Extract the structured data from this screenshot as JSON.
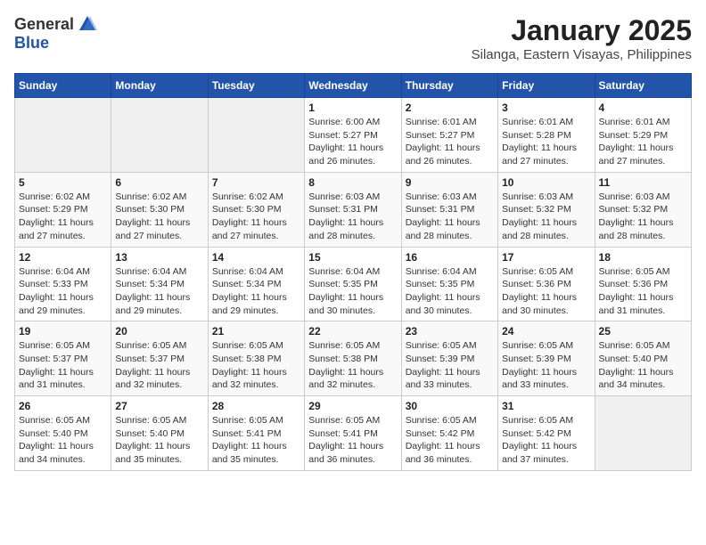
{
  "logo": {
    "general": "General",
    "blue": "Blue"
  },
  "header": {
    "month": "January 2025",
    "location": "Silanga, Eastern Visayas, Philippines"
  },
  "weekdays": [
    "Sunday",
    "Monday",
    "Tuesday",
    "Wednesday",
    "Thursday",
    "Friday",
    "Saturday"
  ],
  "weeks": [
    [
      {
        "day": "",
        "info": ""
      },
      {
        "day": "",
        "info": ""
      },
      {
        "day": "",
        "info": ""
      },
      {
        "day": "1",
        "info": "Sunrise: 6:00 AM\nSunset: 5:27 PM\nDaylight: 11 hours and 26 minutes."
      },
      {
        "day": "2",
        "info": "Sunrise: 6:01 AM\nSunset: 5:27 PM\nDaylight: 11 hours and 26 minutes."
      },
      {
        "day": "3",
        "info": "Sunrise: 6:01 AM\nSunset: 5:28 PM\nDaylight: 11 hours and 27 minutes."
      },
      {
        "day": "4",
        "info": "Sunrise: 6:01 AM\nSunset: 5:29 PM\nDaylight: 11 hours and 27 minutes."
      }
    ],
    [
      {
        "day": "5",
        "info": "Sunrise: 6:02 AM\nSunset: 5:29 PM\nDaylight: 11 hours and 27 minutes."
      },
      {
        "day": "6",
        "info": "Sunrise: 6:02 AM\nSunset: 5:30 PM\nDaylight: 11 hours and 27 minutes."
      },
      {
        "day": "7",
        "info": "Sunrise: 6:02 AM\nSunset: 5:30 PM\nDaylight: 11 hours and 27 minutes."
      },
      {
        "day": "8",
        "info": "Sunrise: 6:03 AM\nSunset: 5:31 PM\nDaylight: 11 hours and 28 minutes."
      },
      {
        "day": "9",
        "info": "Sunrise: 6:03 AM\nSunset: 5:31 PM\nDaylight: 11 hours and 28 minutes."
      },
      {
        "day": "10",
        "info": "Sunrise: 6:03 AM\nSunset: 5:32 PM\nDaylight: 11 hours and 28 minutes."
      },
      {
        "day": "11",
        "info": "Sunrise: 6:03 AM\nSunset: 5:32 PM\nDaylight: 11 hours and 28 minutes."
      }
    ],
    [
      {
        "day": "12",
        "info": "Sunrise: 6:04 AM\nSunset: 5:33 PM\nDaylight: 11 hours and 29 minutes."
      },
      {
        "day": "13",
        "info": "Sunrise: 6:04 AM\nSunset: 5:34 PM\nDaylight: 11 hours and 29 minutes."
      },
      {
        "day": "14",
        "info": "Sunrise: 6:04 AM\nSunset: 5:34 PM\nDaylight: 11 hours and 29 minutes."
      },
      {
        "day": "15",
        "info": "Sunrise: 6:04 AM\nSunset: 5:35 PM\nDaylight: 11 hours and 30 minutes."
      },
      {
        "day": "16",
        "info": "Sunrise: 6:04 AM\nSunset: 5:35 PM\nDaylight: 11 hours and 30 minutes."
      },
      {
        "day": "17",
        "info": "Sunrise: 6:05 AM\nSunset: 5:36 PM\nDaylight: 11 hours and 30 minutes."
      },
      {
        "day": "18",
        "info": "Sunrise: 6:05 AM\nSunset: 5:36 PM\nDaylight: 11 hours and 31 minutes."
      }
    ],
    [
      {
        "day": "19",
        "info": "Sunrise: 6:05 AM\nSunset: 5:37 PM\nDaylight: 11 hours and 31 minutes."
      },
      {
        "day": "20",
        "info": "Sunrise: 6:05 AM\nSunset: 5:37 PM\nDaylight: 11 hours and 32 minutes."
      },
      {
        "day": "21",
        "info": "Sunrise: 6:05 AM\nSunset: 5:38 PM\nDaylight: 11 hours and 32 minutes."
      },
      {
        "day": "22",
        "info": "Sunrise: 6:05 AM\nSunset: 5:38 PM\nDaylight: 11 hours and 32 minutes."
      },
      {
        "day": "23",
        "info": "Sunrise: 6:05 AM\nSunset: 5:39 PM\nDaylight: 11 hours and 33 minutes."
      },
      {
        "day": "24",
        "info": "Sunrise: 6:05 AM\nSunset: 5:39 PM\nDaylight: 11 hours and 33 minutes."
      },
      {
        "day": "25",
        "info": "Sunrise: 6:05 AM\nSunset: 5:40 PM\nDaylight: 11 hours and 34 minutes."
      }
    ],
    [
      {
        "day": "26",
        "info": "Sunrise: 6:05 AM\nSunset: 5:40 PM\nDaylight: 11 hours and 34 minutes."
      },
      {
        "day": "27",
        "info": "Sunrise: 6:05 AM\nSunset: 5:40 PM\nDaylight: 11 hours and 35 minutes."
      },
      {
        "day": "28",
        "info": "Sunrise: 6:05 AM\nSunset: 5:41 PM\nDaylight: 11 hours and 35 minutes."
      },
      {
        "day": "29",
        "info": "Sunrise: 6:05 AM\nSunset: 5:41 PM\nDaylight: 11 hours and 36 minutes."
      },
      {
        "day": "30",
        "info": "Sunrise: 6:05 AM\nSunset: 5:42 PM\nDaylight: 11 hours and 36 minutes."
      },
      {
        "day": "31",
        "info": "Sunrise: 6:05 AM\nSunset: 5:42 PM\nDaylight: 11 hours and 37 minutes."
      },
      {
        "day": "",
        "info": ""
      }
    ]
  ]
}
